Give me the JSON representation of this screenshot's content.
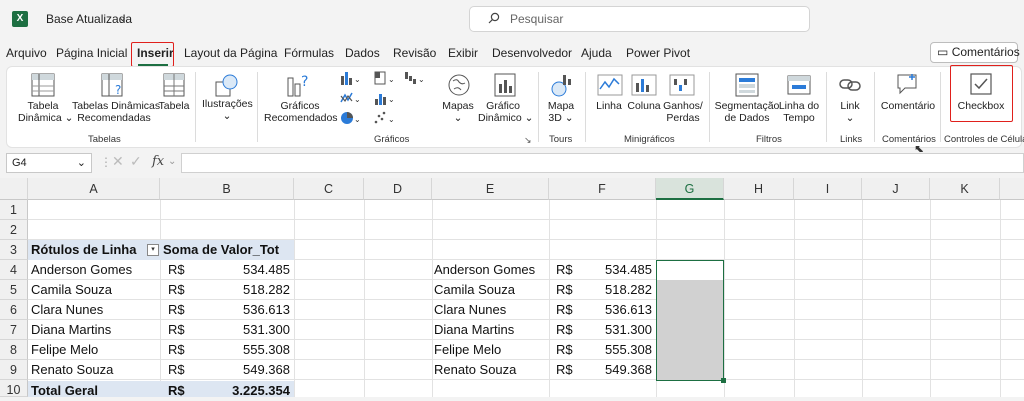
{
  "app": {
    "logo": "X",
    "doc_title": "Base Atualizada",
    "search_placeholder": "Pesquisar"
  },
  "menu": {
    "tabs": [
      "Arquivo",
      "Página Inicial",
      "Inserir",
      "Layout da Página",
      "Fórmulas",
      "Dados",
      "Revisão",
      "Exibir",
      "Desenvolvedor",
      "Ajuda",
      "Power Pivot"
    ],
    "active_tab": "Inserir",
    "comments_button": "Comentários"
  },
  "ribbon": {
    "tabela_dinamica": [
      "Tabela",
      "Dinâmica"
    ],
    "tabelas_recomendadas": [
      "Tabelas Dinâmicas",
      "Recomendadas"
    ],
    "tabela": "Tabela",
    "ilustracoes": "Ilustrações",
    "graficos_recomendados": [
      "Gráficos",
      "Recomendados"
    ],
    "mapas": "Mapas",
    "grafico_dinamico": [
      "Gráfico",
      "Dinâmico"
    ],
    "mapa3d": [
      "Mapa",
      "3D"
    ],
    "linha": "Linha",
    "coluna": "Coluna",
    "ganhos_perdas": [
      "Ganhos/",
      "Perdas"
    ],
    "segmentacao": [
      "Segmentação",
      "de Dados"
    ],
    "linha_do_tempo": [
      "Linha do",
      "Tempo"
    ],
    "link": "Link",
    "comentario": "Comentário",
    "checkbox": "Checkbox",
    "groups": [
      "Tabelas",
      "Gráficos",
      "Tours",
      "Minigráficos",
      "Filtros",
      "Links",
      "Comentários",
      "Controles de Célula"
    ],
    "accent": "#1d6f42",
    "highlight": "#e0201c"
  },
  "formula_bar": {
    "name_box": "G4",
    "fx": "fx"
  },
  "sheet": {
    "columns": [
      "A",
      "B",
      "C",
      "D",
      "E",
      "F",
      "G",
      "H",
      "I",
      "J",
      "K"
    ],
    "selected_column": "G",
    "rows": [
      "1",
      "2",
      "3",
      "4",
      "5",
      "6",
      "7",
      "8",
      "9",
      "10"
    ],
    "pivot_header": {
      "a": "Rótulos de Linha",
      "b": "Soma de Valor_Tot"
    },
    "pivot_rows": [
      {
        "name": "Anderson Gomes",
        "cur": "R$",
        "val": "534.485"
      },
      {
        "name": "Camila Souza",
        "cur": "R$",
        "val": "518.282"
      },
      {
        "name": "Clara Nunes",
        "cur": "R$",
        "val": "536.613"
      },
      {
        "name": "Diana Martins",
        "cur": "R$",
        "val": "531.300"
      },
      {
        "name": "Felipe Melo",
        "cur": "R$",
        "val": "555.308"
      },
      {
        "name": "Renato Souza",
        "cur": "R$",
        "val": "549.368"
      }
    ],
    "total": {
      "name": "Total Geral",
      "cur": "R$",
      "val": "3.225.354"
    },
    "table2": [
      {
        "name": "Anderson Gomes",
        "cur": "R$",
        "val": "534.485"
      },
      {
        "name": "Camila Souza",
        "cur": "R$",
        "val": "518.282"
      },
      {
        "name": "Clara Nunes",
        "cur": "R$",
        "val": "536.613"
      },
      {
        "name": "Diana Martins",
        "cur": "R$",
        "val": "531.300"
      },
      {
        "name": "Felipe Melo",
        "cur": "R$",
        "val": "555.308"
      },
      {
        "name": "Renato Souza",
        "cur": "R$",
        "val": "549.368"
      }
    ]
  }
}
